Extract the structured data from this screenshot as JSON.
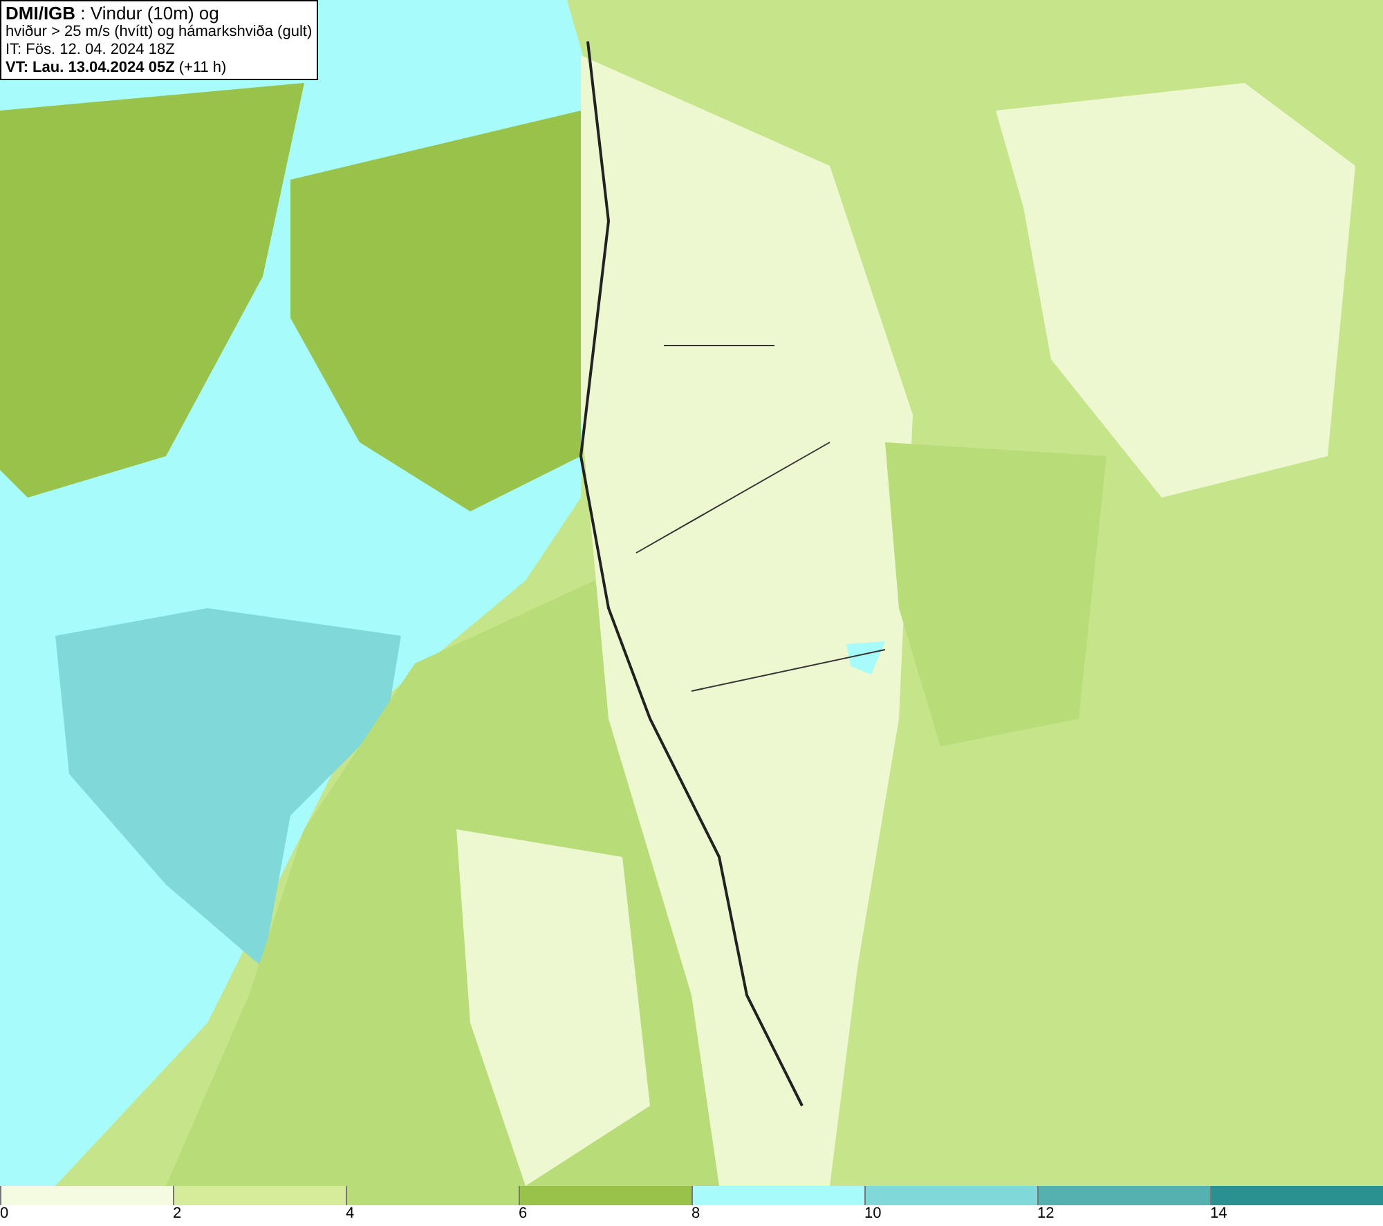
{
  "info": {
    "lines": [
      "**DMI/IGB** : Vindur (10m) og",
      "hviður > 25 m/s (hvítt) og hámarkshviða (gult)",
      "IT: Fös. 12. 04. 2024 18Z",
      "**VT: Lau. 13.04.2024 05Z** (+11 h)"
    ]
  },
  "colorbar": {
    "bins": [
      {
        "label": "0",
        "color": "#f5fbe0"
      },
      {
        "label": "2",
        "color": "#d5ec9a"
      },
      {
        "label": "4",
        "color": "#b8dc78"
      },
      {
        "label": "6",
        "color": "#99c24a"
      },
      {
        "label": "8",
        "color": "#a8fbfb"
      },
      {
        "label": "10",
        "color": "#80d8d8"
      },
      {
        "label": "12",
        "color": "#55b0b0"
      },
      {
        "label": "14",
        "color": "#2a9090"
      }
    ]
  }
}
